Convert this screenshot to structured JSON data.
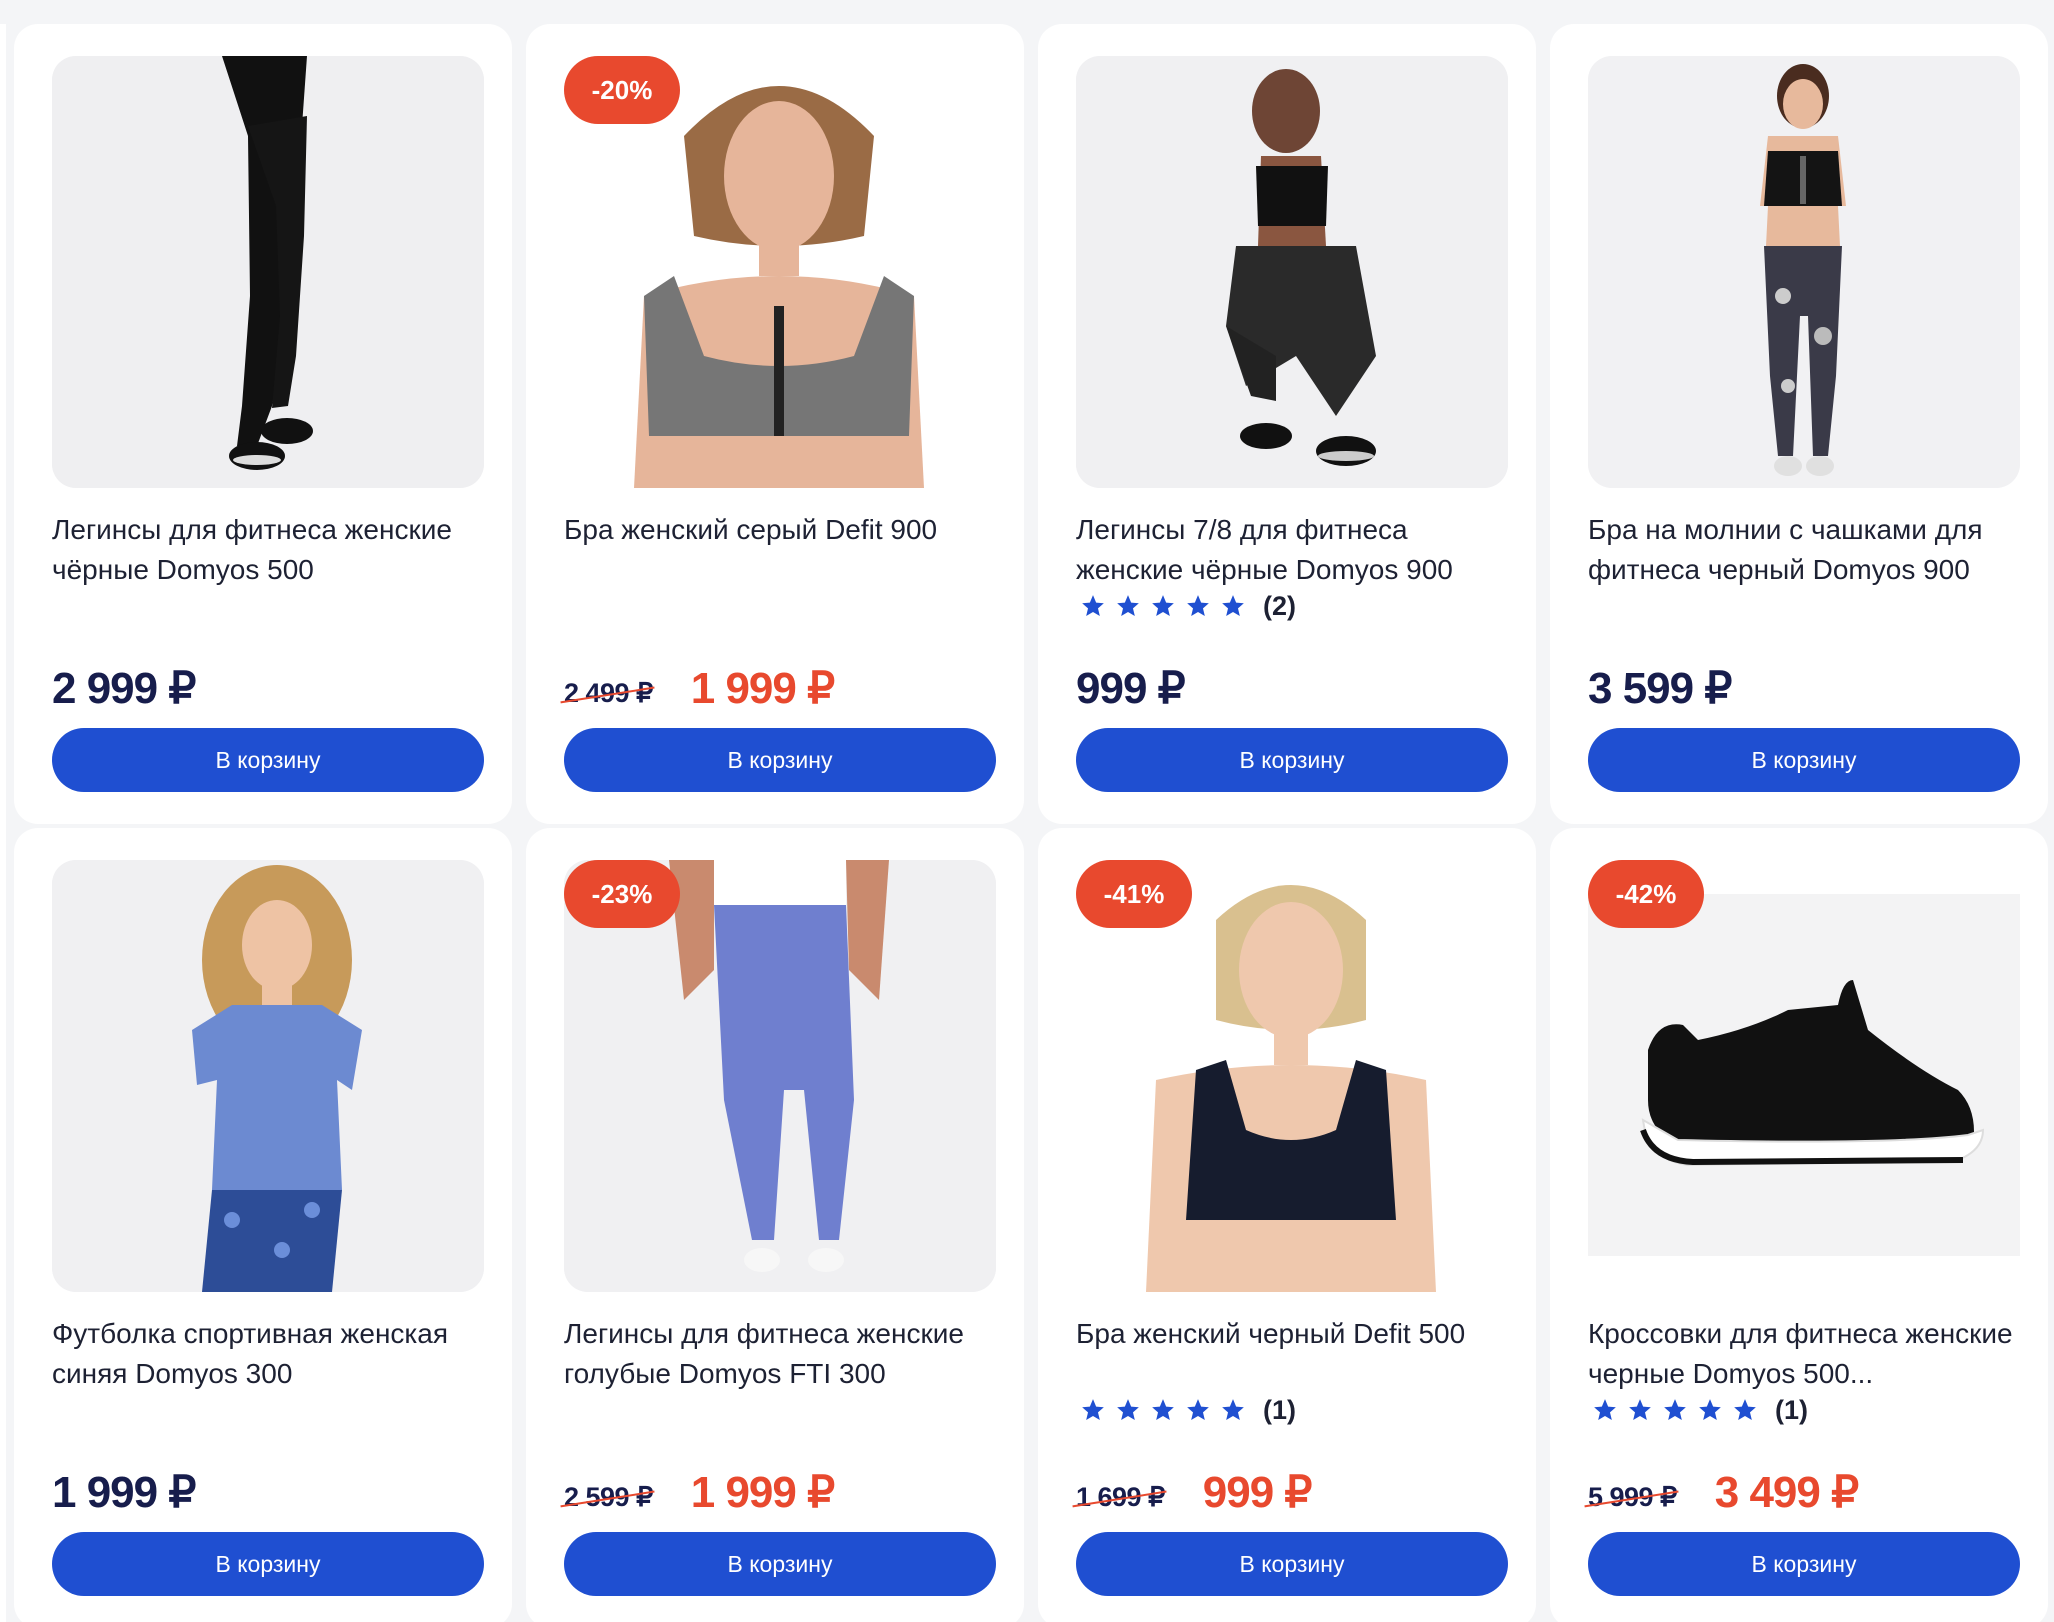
{
  "products": [
    {
      "title": "Легинсы для фитнеса женские чёрные Domyos 500",
      "badge": "",
      "old_price": "",
      "price": "2 999 ₽",
      "rating_count": "",
      "rating_stars": 0,
      "button": "В корзину",
      "image": "black-leggings"
    },
    {
      "title": "Бра женский серый Defit 900",
      "badge": "-20%",
      "old_price": "2 499 ₽",
      "price": "1 999 ₽",
      "rating_count": "",
      "rating_stars": 0,
      "button": "В корзину",
      "image": "grey-bra"
    },
    {
      "title": "Легинсы 7/8 для фитнеса женские чёрные Domyos 900",
      "badge": "",
      "old_price": "",
      "price": "999 ₽",
      "rating_count": "(2)",
      "rating_stars": 5,
      "button": "В корзину",
      "image": "black-7-8-leggings"
    },
    {
      "title": "Бра на молнии с чашками для фитнеса черный Domyos 900",
      "badge": "",
      "old_price": "",
      "price": "3 599 ₽",
      "rating_count": "",
      "rating_stars": 0,
      "button": "В корзину",
      "image": "zip-bra"
    },
    {
      "title": "Футболка спортивная женская синяя Domyos 300",
      "badge": "",
      "old_price": "",
      "price": "1 999 ₽",
      "rating_count": "",
      "rating_stars": 0,
      "button": "В корзину",
      "image": "blue-tshirt"
    },
    {
      "title": "Легинсы для фитнеса женские голубые Domyos FTI 300",
      "badge": "-23%",
      "old_price": "2 599 ₽",
      "price": "1 999 ₽",
      "rating_count": "",
      "rating_stars": 0,
      "button": "В корзину",
      "image": "blue-leggings"
    },
    {
      "title": "Бра женский черный Defit 500",
      "badge": "-41%",
      "old_price": "1 699 ₽",
      "price": "999 ₽",
      "rating_count": "(1)",
      "rating_stars": 5,
      "button": "В корзину",
      "image": "black-bra"
    },
    {
      "title": "Кроссовки для фитнеса женские черные Domyos 500...",
      "badge": "-42%",
      "old_price": "5 999 ₽",
      "price": "3 499 ₽",
      "rating_count": "(1)",
      "rating_stars": 5,
      "button": "В корзину",
      "image": "black-sneakers"
    }
  ],
  "colors": {
    "button": "#1f4fd1",
    "sale": "#e8492e",
    "price": "#171d4c",
    "star": "#1f4fd1",
    "background": "#f4f5f7"
  }
}
